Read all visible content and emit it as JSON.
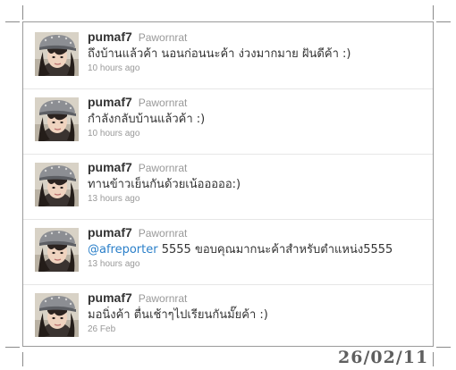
{
  "tweets": [
    {
      "screen_name": "pumaf7",
      "real_name": "Pawornrat",
      "mention": "",
      "text": "ถึงบ้านแล้วค้า นอนก่อนนะค้า ง่วงมากมาย ฝันดีค้า :)",
      "time": "10 hours ago"
    },
    {
      "screen_name": "pumaf7",
      "real_name": "Pawornrat",
      "mention": "",
      "text": "กำลังกลับบ้านแล้วค้า :)",
      "time": "10 hours ago"
    },
    {
      "screen_name": "pumaf7",
      "real_name": "Pawornrat",
      "mention": "",
      "text": "ทานข้าวเย็นกันด้วยเน้อออออ:)",
      "time": "13 hours ago"
    },
    {
      "screen_name": "pumaf7",
      "real_name": "Pawornrat",
      "mention": "@afreporter",
      "text": " 5555 ขอบคุณมากนะค้าสำหรับตำแหน่ง5555",
      "time": "13 hours ago"
    },
    {
      "screen_name": "pumaf7",
      "real_name": "Pawornrat",
      "mention": "",
      "text": "มอนิ่งค้า ตื่นเช้าๆไปเรียนกันมั๊ยค้า :)",
      "time": "26 Feb"
    }
  ],
  "stamp_date": "26/02/11",
  "colors": {
    "screen_name": "#333333",
    "meta": "#999999",
    "mention": "#2a7fc9",
    "border": "#9a9a9a"
  }
}
